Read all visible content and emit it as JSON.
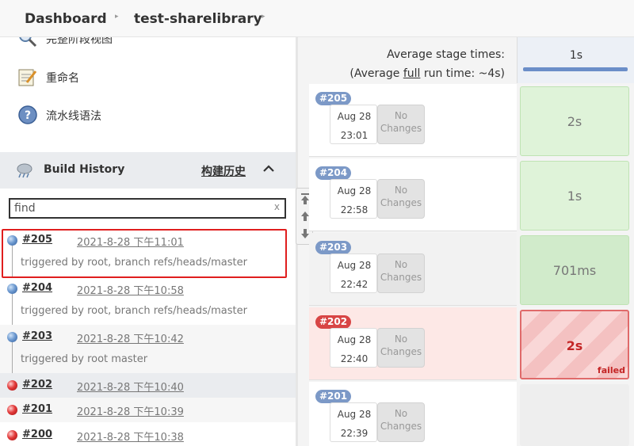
{
  "breadcrumb": {
    "items": [
      "Dashboard",
      "test-sharelibrary"
    ]
  },
  "sidebar": {
    "tasks": [
      {
        "label": "完整阶段视图",
        "icon": "magnifier-icon"
      },
      {
        "label": "重命名",
        "icon": "notepad-icon"
      },
      {
        "label": "流水线语法",
        "icon": "help-icon"
      }
    ]
  },
  "build_history": {
    "title": "Build History",
    "trend_label": "构建历史",
    "search": {
      "placeholder": "find",
      "clear": "x"
    },
    "builds": [
      {
        "number": "#205",
        "date": "2021-8-28 下午11:01",
        "cause": "triggered by root, branch refs/heads/master",
        "status": "success"
      },
      {
        "number": "#204",
        "date": "2021-8-28 下午10:58",
        "cause": "triggered by root, branch refs/heads/master",
        "status": "success"
      },
      {
        "number": "#203",
        "date": "2021-8-28 下午10:42",
        "cause": "triggered by root master",
        "status": "success"
      },
      {
        "number": "#202",
        "date": "2021-8-28 下午10:40",
        "cause": "",
        "status": "failed"
      },
      {
        "number": "#201",
        "date": "2021-8-28 下午10:39",
        "cause": "",
        "status": "failed"
      },
      {
        "number": "#200",
        "date": "2021-8-28 下午10:38",
        "cause": "",
        "status": "failed"
      }
    ]
  },
  "stage_view": {
    "avg_stage_label": "Average stage times:",
    "avg_run_prefix": "(Average ",
    "avg_run_link": "full",
    "avg_run_suffix": " run time: ~4s)",
    "column_time": "1s",
    "no_changes": "No Changes",
    "rows": [
      {
        "badge": "#205",
        "month": "Aug 28",
        "time": "23:01",
        "stage": "2s",
        "status": "success"
      },
      {
        "badge": "#204",
        "month": "Aug 28",
        "time": "22:58",
        "stage": "1s",
        "status": "success"
      },
      {
        "badge": "#203",
        "month": "Aug 28",
        "time": "22:42",
        "stage": "701ms",
        "status": "success"
      },
      {
        "badge": "#202",
        "month": "Aug 28",
        "time": "22:40",
        "stage": "2s",
        "status": "failed",
        "tag": "failed"
      },
      {
        "badge": "#201",
        "month": "Aug 28",
        "time": "22:39",
        "stage": "",
        "status": "none"
      }
    ]
  },
  "colors": {
    "accent_blue": "#6b8ec8",
    "success_green": "#dff3d9",
    "failure_red": "#d84545",
    "selection_outline": "#e01e1e"
  }
}
